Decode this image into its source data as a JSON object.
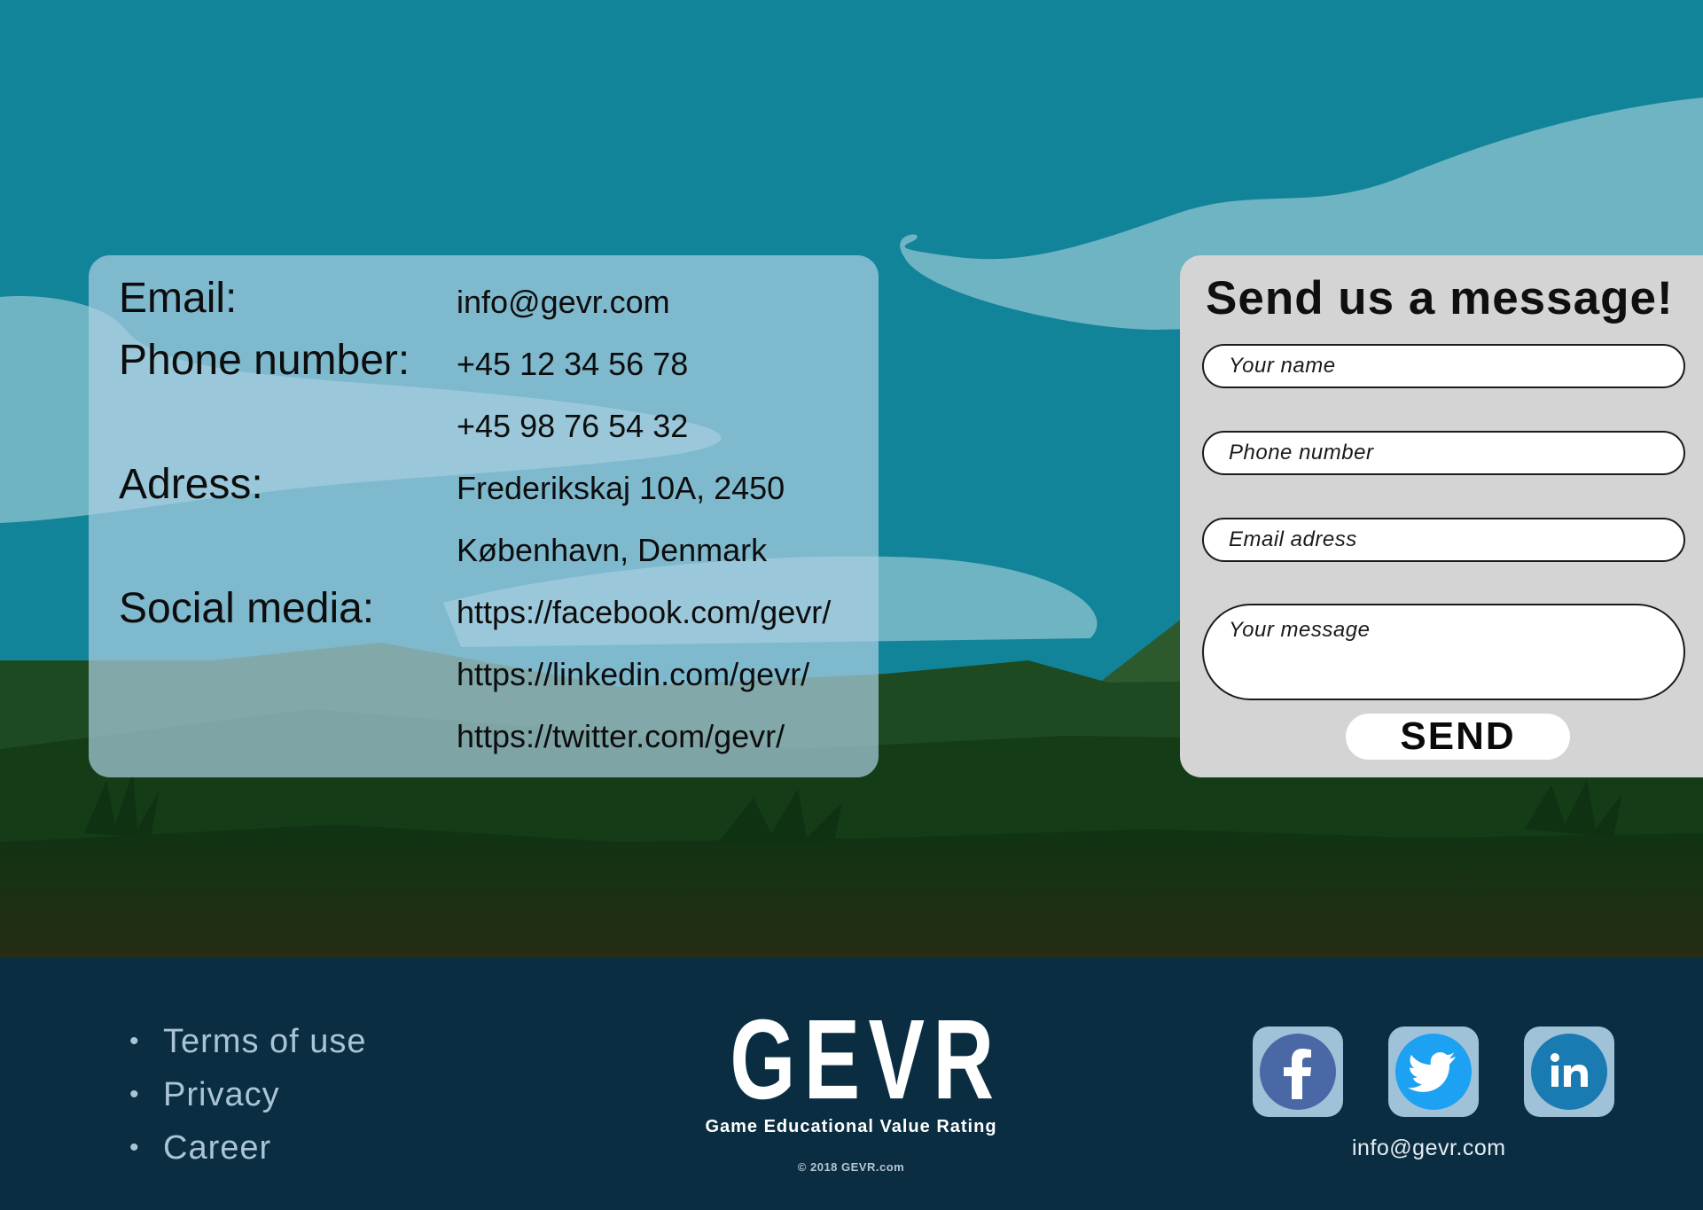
{
  "contact_info": {
    "email_label": "Email:",
    "email_value": "info@gevr.com",
    "phone_label": "Phone number:",
    "phones": [
      "+45 12 34 56 78",
      "+45 98 76 54 32"
    ],
    "address_label": "Adress:",
    "address_lines": [
      "Frederikskaj 10A, 2450",
      "København, Denmark"
    ],
    "social_label": "Social media:",
    "social_links": [
      "https://facebook.com/gevr/",
      "https://linkedin.com/gevr/",
      "https://twitter.com/gevr/"
    ]
  },
  "message_form": {
    "title": "Send us a message!",
    "name_placeholder": "Your name",
    "phone_placeholder": "Phone number",
    "email_placeholder": "Email adress",
    "message_placeholder": "Your message",
    "send_label": "SEND"
  },
  "footer": {
    "links": [
      "Terms of use",
      "Privacy",
      "Career"
    ],
    "brand": "GEVR",
    "tagline": "Game Educational Value Rating",
    "copyright": "© 2018 GEVR.com",
    "social_icons": [
      "facebook-icon",
      "twitter-icon",
      "linkedin-icon"
    ],
    "email": "info@gevr.com"
  },
  "colors": {
    "sky": "#12849a",
    "cloud": "#6fb4c3",
    "hills_dark": "#143d17",
    "footer_bg": "#0b2d42",
    "facebook": "#4a68a6",
    "twitter": "#1da1f2",
    "linkedin": "#1a7ab2"
  }
}
